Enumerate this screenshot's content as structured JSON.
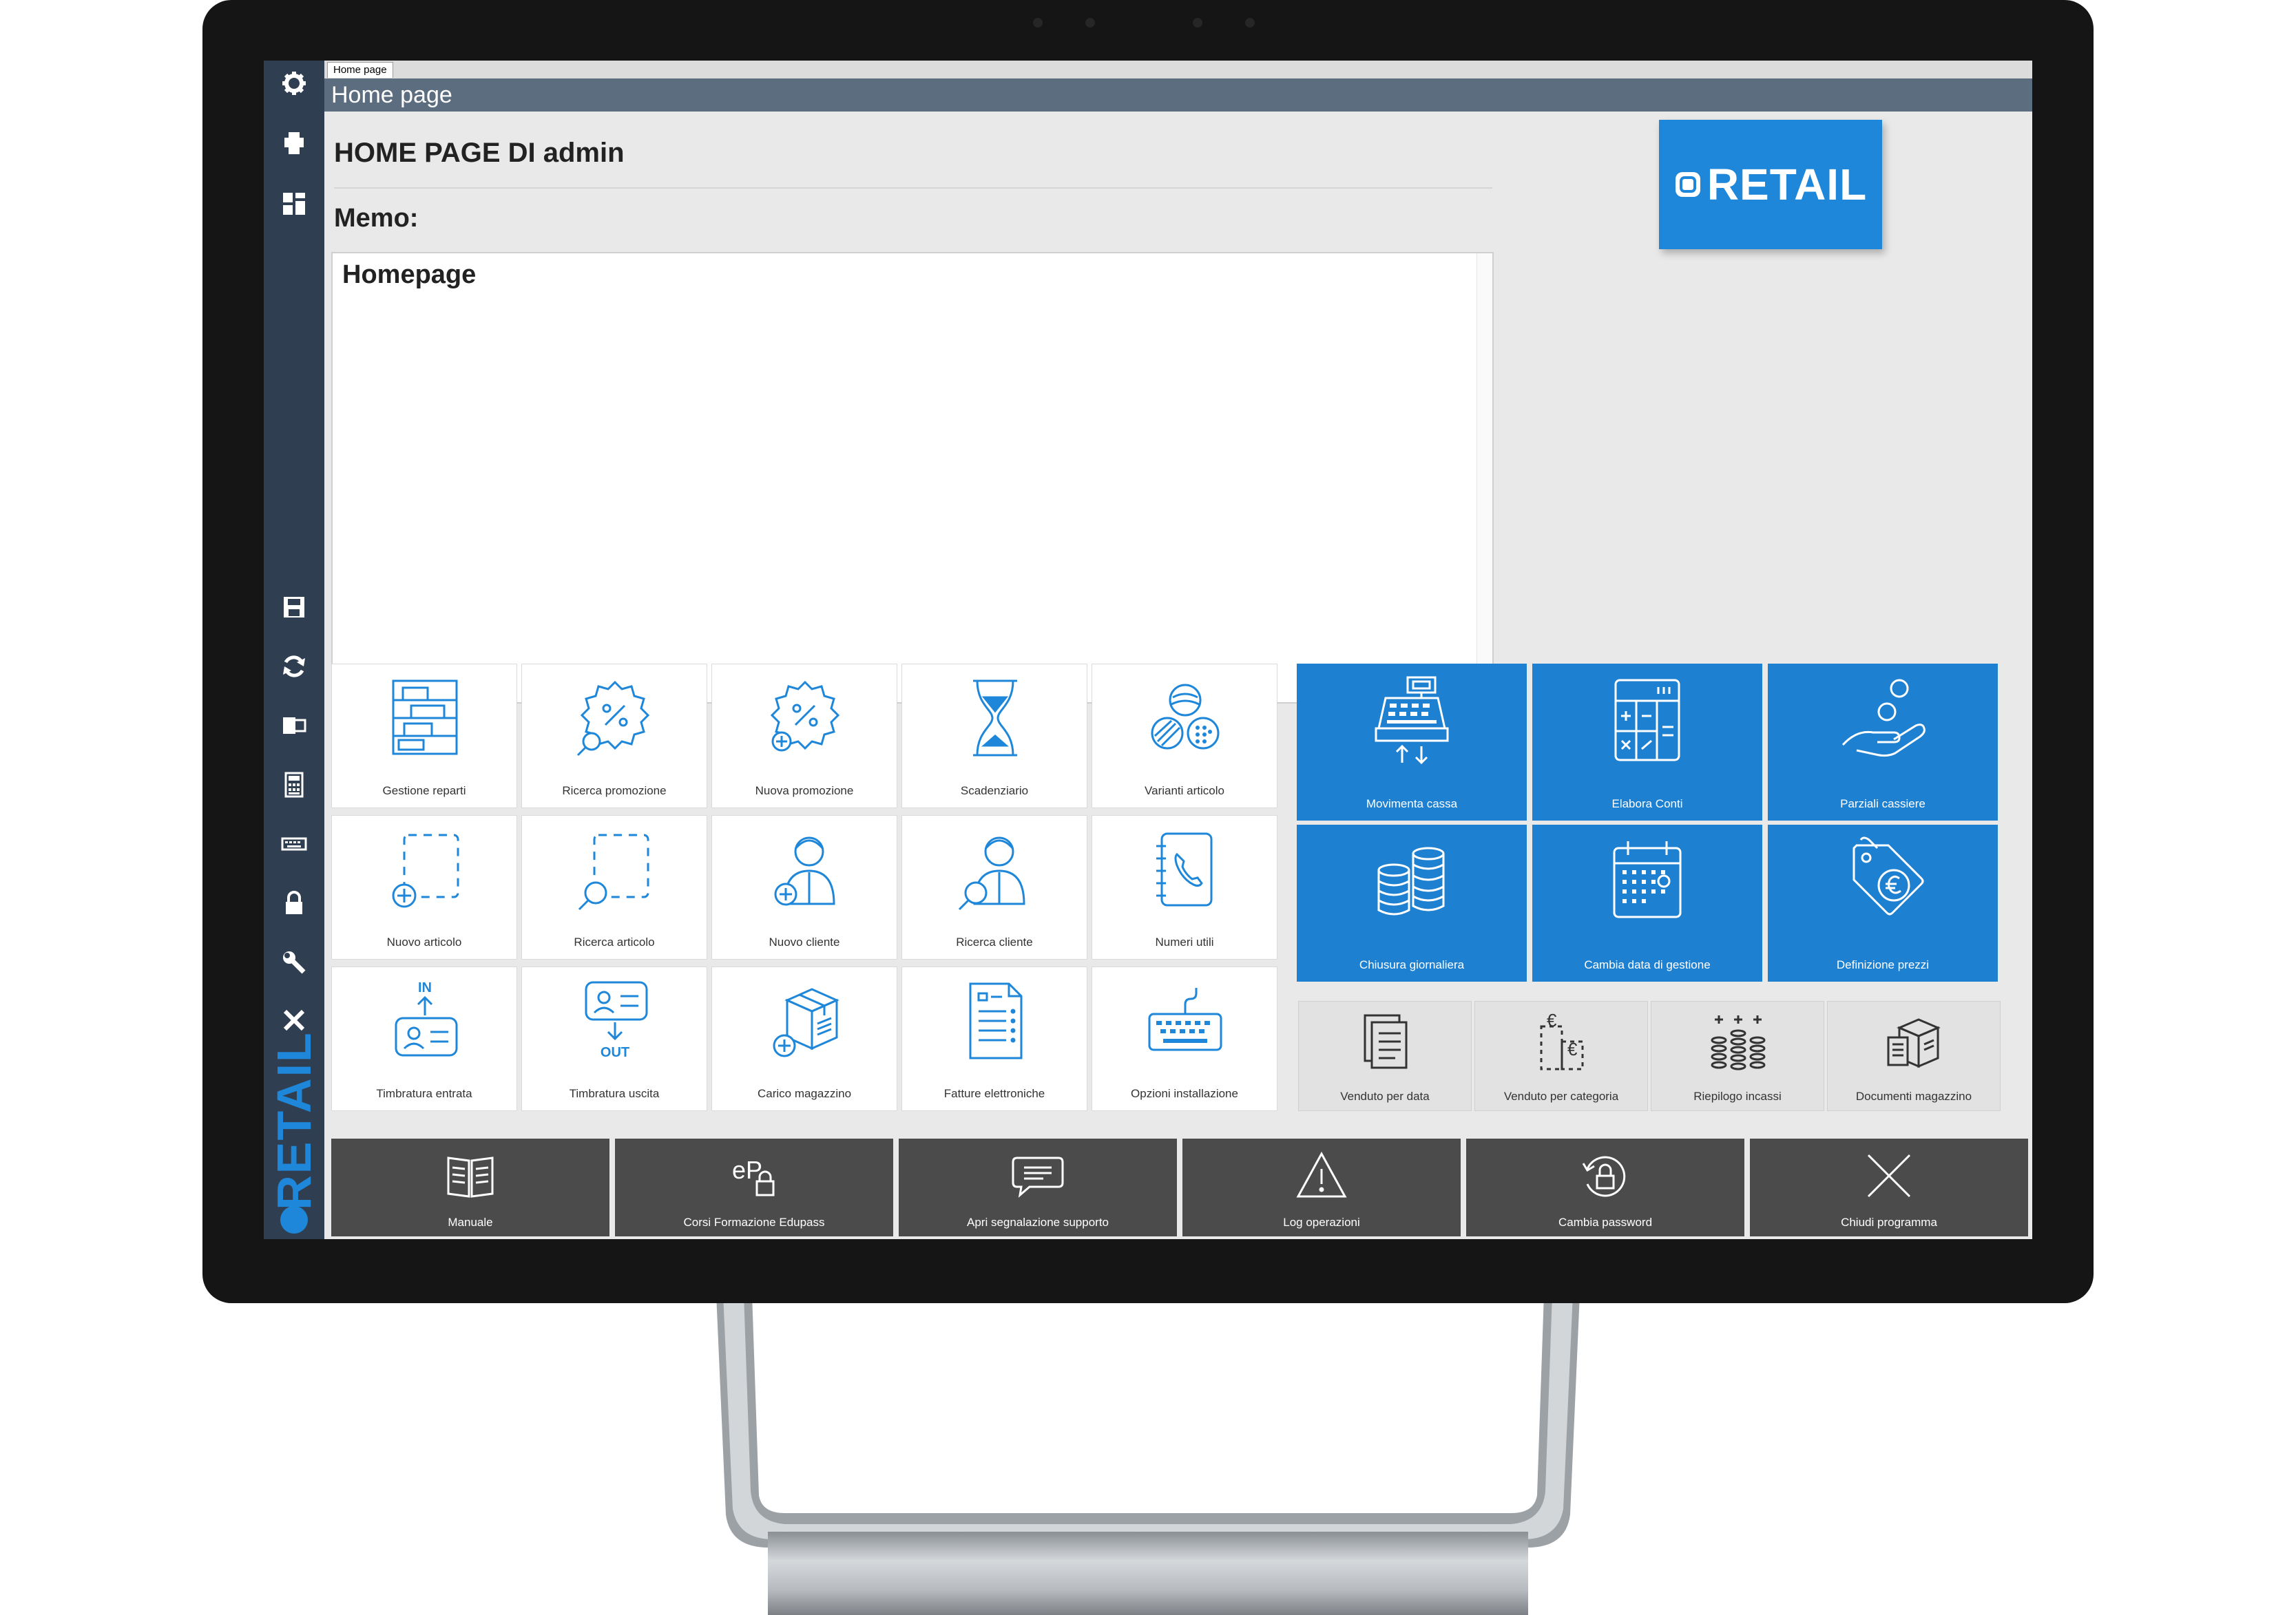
{
  "tab": {
    "label": "Home page"
  },
  "header": {
    "title": "Home page"
  },
  "greeting": "HOME PAGE DI admin",
  "memo": {
    "label": "Memo:",
    "text": "Homepage"
  },
  "brand": {
    "logo_text": "RETAIL",
    "rail_text": "RETAIL",
    "color": "#1e87d9"
  },
  "sidebar": {
    "icons": [
      "gear-icon",
      "printer-icon",
      "dashboard-icon",
      "save-icon",
      "refresh-icon",
      "export-icon",
      "calculator-icon",
      "keyboard-icon",
      "lock-icon",
      "wrench-icon",
      "close-icon"
    ]
  },
  "tiles": [
    {
      "label": "Gestione reparti",
      "icon": "shelves-icon"
    },
    {
      "label": "Ricerca promozione",
      "icon": "promo-search-icon"
    },
    {
      "label": "Nuova promozione",
      "icon": "promo-add-icon"
    },
    {
      "label": "Scadenziario",
      "icon": "hourglass-icon"
    },
    {
      "label": "Varianti articolo",
      "icon": "variants-icon"
    },
    {
      "label": "Nuovo articolo",
      "icon": "article-add-icon"
    },
    {
      "label": "Ricerca articolo",
      "icon": "article-search-icon"
    },
    {
      "label": "Nuovo cliente",
      "icon": "customer-add-icon"
    },
    {
      "label": "Ricerca cliente",
      "icon": "customer-search-icon"
    },
    {
      "label": "Numeri utili",
      "icon": "phonebook-icon"
    },
    {
      "label": "Timbratura entrata",
      "icon": "clock-in-icon",
      "badge": "IN"
    },
    {
      "label": "Timbratura uscita",
      "icon": "clock-out-icon",
      "badge": "OUT"
    },
    {
      "label": "Carico magazzino",
      "icon": "warehouse-load-icon"
    },
    {
      "label": "Fatture elettroniche",
      "icon": "e-invoice-icon"
    },
    {
      "label": "Opzioni installazione",
      "icon": "keyboard-icon"
    }
  ],
  "blue_tiles": [
    {
      "label": "Movimenta cassa",
      "icon": "cash-register-icon"
    },
    {
      "label": "Elabora Conti",
      "icon": "calculator-icon"
    },
    {
      "label": "Parziali cassiere",
      "icon": "hand-coin-icon"
    },
    {
      "label": "Chiusura giornaliera",
      "icon": "coins-icon"
    },
    {
      "label": "Cambia data di gestione",
      "icon": "calendar-icon"
    },
    {
      "label": "Definizione prezzi",
      "icon": "price-tag-icon"
    }
  ],
  "report_tiles": [
    {
      "label": "Venduto per data",
      "icon": "documents-icon"
    },
    {
      "label": "Venduto per categoria",
      "icon": "euro-category-icon"
    },
    {
      "label": "Riepilogo incassi",
      "icon": "coins-stack-icon"
    },
    {
      "label": "Documenti magazzino",
      "icon": "warehouse-docs-icon"
    }
  ],
  "bottom_bar": [
    {
      "label": "Manuale",
      "icon": "book-icon"
    },
    {
      "label": "Corsi Formazione Edupass",
      "icon": "edupass-icon"
    },
    {
      "label": "Apri segnalazione supporto",
      "icon": "chat-icon"
    },
    {
      "label": "Log operazioni",
      "icon": "warning-icon"
    },
    {
      "label": "Cambia password",
      "icon": "lock-rotate-icon"
    },
    {
      "label": "Chiudi programma",
      "icon": "close-icon"
    }
  ],
  "colors": {
    "accent": "#1e87d9",
    "tile_blue": "#1e80d1",
    "rail": "#2f3e51",
    "titlebar": "#5d6d80",
    "bottom_bar": "#4b4b4b"
  }
}
